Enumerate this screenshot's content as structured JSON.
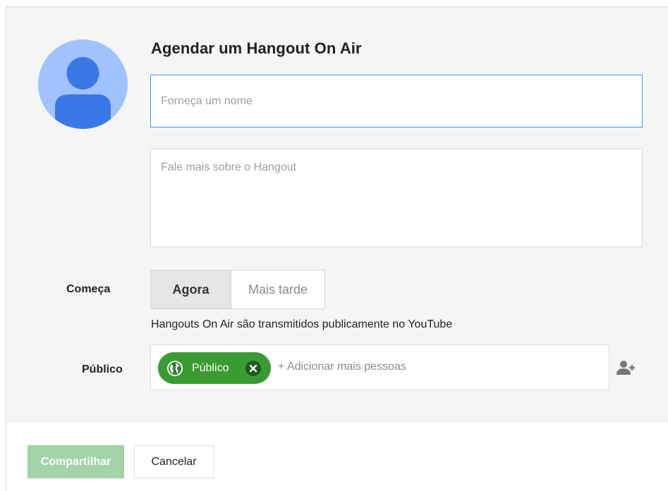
{
  "dialog": {
    "title": "Agendar um Hangout On Air",
    "avatar_icon": "default-user-avatar"
  },
  "form": {
    "name_placeholder": "Forneça um nome",
    "name_value": "",
    "description_placeholder": "Fale mais sobre o Hangout",
    "description_value": ""
  },
  "starts": {
    "label": "Começa",
    "options": [
      "Agora",
      "Mais tarde"
    ],
    "selected": "Agora",
    "notice": "Hangouts On Air são transmitidos publicamente no YouTube"
  },
  "audience": {
    "label": "Público",
    "chips": [
      {
        "label": "Público",
        "icon": "globe-icon",
        "remove_icon": "close-icon"
      }
    ],
    "add_placeholder": "+ Adicionar mais pessoas",
    "add_person_icon": "add-person-icon"
  },
  "footer": {
    "share_label": "Compartilhar",
    "cancel_label": "Cancelar"
  },
  "colors": {
    "panel_bg": "#f5f5f5",
    "focus_border": "#4d90fe",
    "chip_green": "#3a9b33",
    "share_disabled": "#a3d3a8",
    "avatar_bg": "#a0c3ff",
    "avatar_fg": "#3b78e7"
  }
}
